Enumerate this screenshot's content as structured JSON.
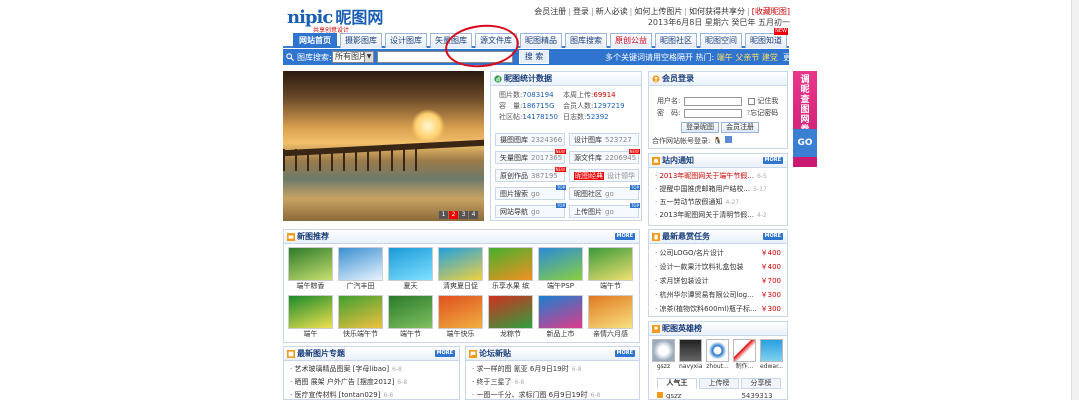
{
  "logo": {
    "text_latin": "nipic",
    "text_cn": "昵图网",
    "slogan": "共享创意设计"
  },
  "toplinks": {
    "register": "会员注册",
    "login": "登录",
    "guide": "新人必读",
    "upload": "如何上传图片",
    "earn": "如何获得共享分",
    "favorite": "[收藏昵图]",
    "date": "2013年6月8日 星期六 癸巳年 五月初一"
  },
  "nav": [
    {
      "label": "网站首页"
    },
    {
      "label": "摄影图库"
    },
    {
      "label": "设计图库"
    },
    {
      "label": "矢量图库"
    },
    {
      "label": "源文件库"
    },
    {
      "label": "昵图精品"
    },
    {
      "label": "图库搜索"
    },
    {
      "label": "原创公益"
    },
    {
      "label": "昵图社区"
    },
    {
      "label": "昵图空间"
    },
    {
      "label": "昵图知道"
    }
  ],
  "search": {
    "label": "图库搜索:",
    "category": "所有图片",
    "button": "搜 索",
    "tip_prefix": "多个关键词请用空格隔开 热门:",
    "hot1": "端午",
    "hot2": "父亲节",
    "hot3": "建党",
    "more": "更多..."
  },
  "photo_pager": [
    "1",
    "2",
    "3",
    "4"
  ],
  "stats": {
    "title": "昵图统计数据",
    "images_label": "图片数:",
    "images": "7083194",
    "week_label": "本周上传:",
    "week": "69914",
    "capacity_label": "容　量:",
    "capacity": "186715G",
    "members_label": "会员人数:",
    "members": "1297219",
    "community_label": "社区帖:",
    "community": "14178150",
    "today_label": "日志数:",
    "today": "52392",
    "cats": [
      {
        "label": "摄图图库",
        "num": "2324366",
        "badge": ""
      },
      {
        "label": "设计图库",
        "num": "523727",
        "badge": ""
      },
      {
        "label": "矢量图库",
        "num": "2017365",
        "badge": "NEW"
      },
      {
        "label": "源文件库",
        "num": "2206945",
        "badge": "NEW"
      },
      {
        "label": "原创作品",
        "num": "387195",
        "badge": "NEW"
      },
      {
        "label": "昵图经典",
        "num": "设计领华",
        "badge": ""
      },
      {
        "label": "图片搜索",
        "num": "go",
        "badge": "TOP"
      },
      {
        "label": "昵图社区",
        "num": "go",
        "badge": "TOP"
      },
      {
        "label": "网站导航",
        "num": "go",
        "badge": "TOP"
      },
      {
        "label": "上传图片",
        "num": "go",
        "badge": "TOP"
      }
    ]
  },
  "login": {
    "title": "会员登录",
    "user_label": "用户名:",
    "pwd_label": "密　码:",
    "remember": "记住我",
    "forgot": "忘记密码",
    "login_btn": "登录昵图",
    "reg_btn": "会员注册",
    "partner": "合作网站帐号登录:"
  },
  "notice": {
    "title": "站内通知",
    "more": "MORE",
    "items": [
      {
        "text": "2013年昵图网关于端午节假...",
        "date": "6-5",
        "red": true
      },
      {
        "text": "提醒中国推虎邮箱用户结校...",
        "date": "5-17",
        "red": false
      },
      {
        "text": "五一劳动节放假通知",
        "date": "4-27",
        "red": false
      },
      {
        "text": "2013年昵图网关于清明节假...",
        "date": "4-2",
        "red": false
      }
    ]
  },
  "task": {
    "title": "最新悬赏任务",
    "more": "MORE",
    "items": [
      {
        "text": "公司LOGO/名片设计",
        "price": "￥400"
      },
      {
        "text": "设计一款果汁饮料礼盒包装",
        "price": "￥400"
      },
      {
        "text": "求月饼包装设计",
        "price": "￥700"
      },
      {
        "text": "杭州华尔谭贸易有限公司log...",
        "price": "￥300"
      },
      {
        "text": "凉茶(植物饮料600ml)瓶子标...",
        "price": "￥300"
      }
    ]
  },
  "rank": {
    "title": "昵图英雄榜",
    "users": [
      "gszz",
      "navyxia",
      "zhout...",
      "制作...",
      "edwar..."
    ],
    "tabs": [
      "人气王",
      "上传榜",
      "分享榜"
    ],
    "top_user": "gszz",
    "top_score": "5439313"
  },
  "ad": {
    "text": "调昵查图网卷",
    "go": "GO"
  },
  "newimg": {
    "title": "新图推荐",
    "more": "MORE",
    "items": [
      {
        "cap": "端午粽香",
        "c1": "#2d7a2a",
        "c2": "#c8e070"
      },
      {
        "cap": "广汽丰田",
        "c1": "#3a8fd0",
        "c2": "#e8f4ff"
      },
      {
        "cap": "夏天",
        "c1": "#1a9ad8",
        "c2": "#80e0ff"
      },
      {
        "cap": "清爽夏日促",
        "c1": "#22a0e0",
        "c2": "#f0d040"
      },
      {
        "cap": "乐享水果 缤",
        "c1": "#48b030",
        "c2": "#f09020"
      },
      {
        "cap": "端午PSP",
        "c1": "#2a8ad8",
        "c2": "#8ad040"
      },
      {
        "cap": "端午节",
        "c1": "#3a9a3a",
        "c2": "#f0e070"
      },
      {
        "cap": "端午",
        "c1": "#1a8a2a",
        "c2": "#f0e050"
      },
      {
        "cap": "快乐端午节",
        "c1": "#40a030",
        "c2": "#f0c040"
      },
      {
        "cap": "端午节",
        "c1": "#2a7a2a",
        "c2": "#80c060"
      },
      {
        "cap": "端午快乐",
        "c1": "#e05020",
        "c2": "#f0b040"
      },
      {
        "cap": "龙粽节",
        "c1": "#d03020",
        "c2": "#30a040"
      },
      {
        "cap": "新品上市",
        "c1": "#1a80d0",
        "c2": "#e03a8a"
      },
      {
        "cap": "亲情六月感",
        "c1": "#e07a20",
        "c2": "#f8e080"
      }
    ]
  },
  "latest": {
    "title": "最新图片专题",
    "more": "MORE",
    "items": [
      {
        "text": "艺术玻璃精品图案 [字母libao]",
        "date": "6-8"
      },
      {
        "text": "晒图 展架 户外广告 [摆度2012]",
        "date": "6-8"
      },
      {
        "text": "医疗宣传材料 [tontan029]",
        "date": "6-8"
      }
    ]
  },
  "forum": {
    "title": "论坛新贴",
    "more": "MORE",
    "items": [
      {
        "text": "求一样的图 氰亚 6月9日19时",
        "date": "6-8"
      },
      {
        "text": "终于三星了",
        "date": "6-8"
      },
      {
        "text": "一图一千分、求标门图 6月9日19时",
        "date": "6-8"
      }
    ]
  }
}
